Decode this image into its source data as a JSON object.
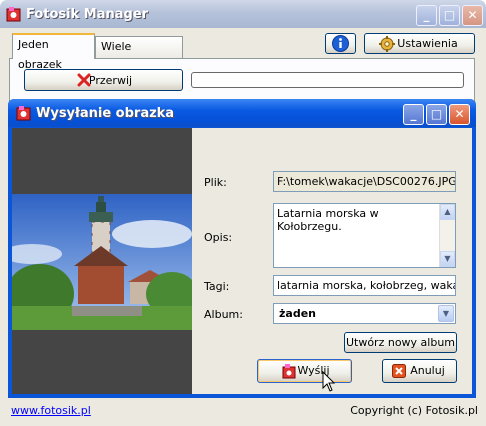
{
  "main_window": {
    "title": "Fotosik Manager",
    "tabs": [
      {
        "label": "Jeden obrazek"
      },
      {
        "label": "Wiele obrazków"
      }
    ],
    "settings_label": "Ustawienia",
    "cancel_upload_label": "Przerwij",
    "footer_link": "www.fotosik.pl",
    "footer_copyright": "Copyright (c) Fotosik.pl"
  },
  "dialog": {
    "title": "Wysyłanie obrazka",
    "file_label": "Plik:",
    "file_value": "F:\\tomek\\wakacje\\DSC00276.JPG",
    "desc_label": "Opis:",
    "desc_value": "Latarnia morska w Kołobrzegu.",
    "tags_label": "Tagi:",
    "tags_value": "latarnia morska, kołobrzeg, wakacje",
    "album_label": "Album:",
    "album_value": "żaden",
    "new_album_label": "Utwórz nowy album",
    "send_label": "Wyślij",
    "cancel_label": "Anuluj"
  },
  "colors": {
    "titlebar_active": "#0550d6",
    "titlebar_inactive": "#b5c2da",
    "window_bg": "#eceae0",
    "tab_highlight": "#f2b63a",
    "link": "#0000ff"
  }
}
